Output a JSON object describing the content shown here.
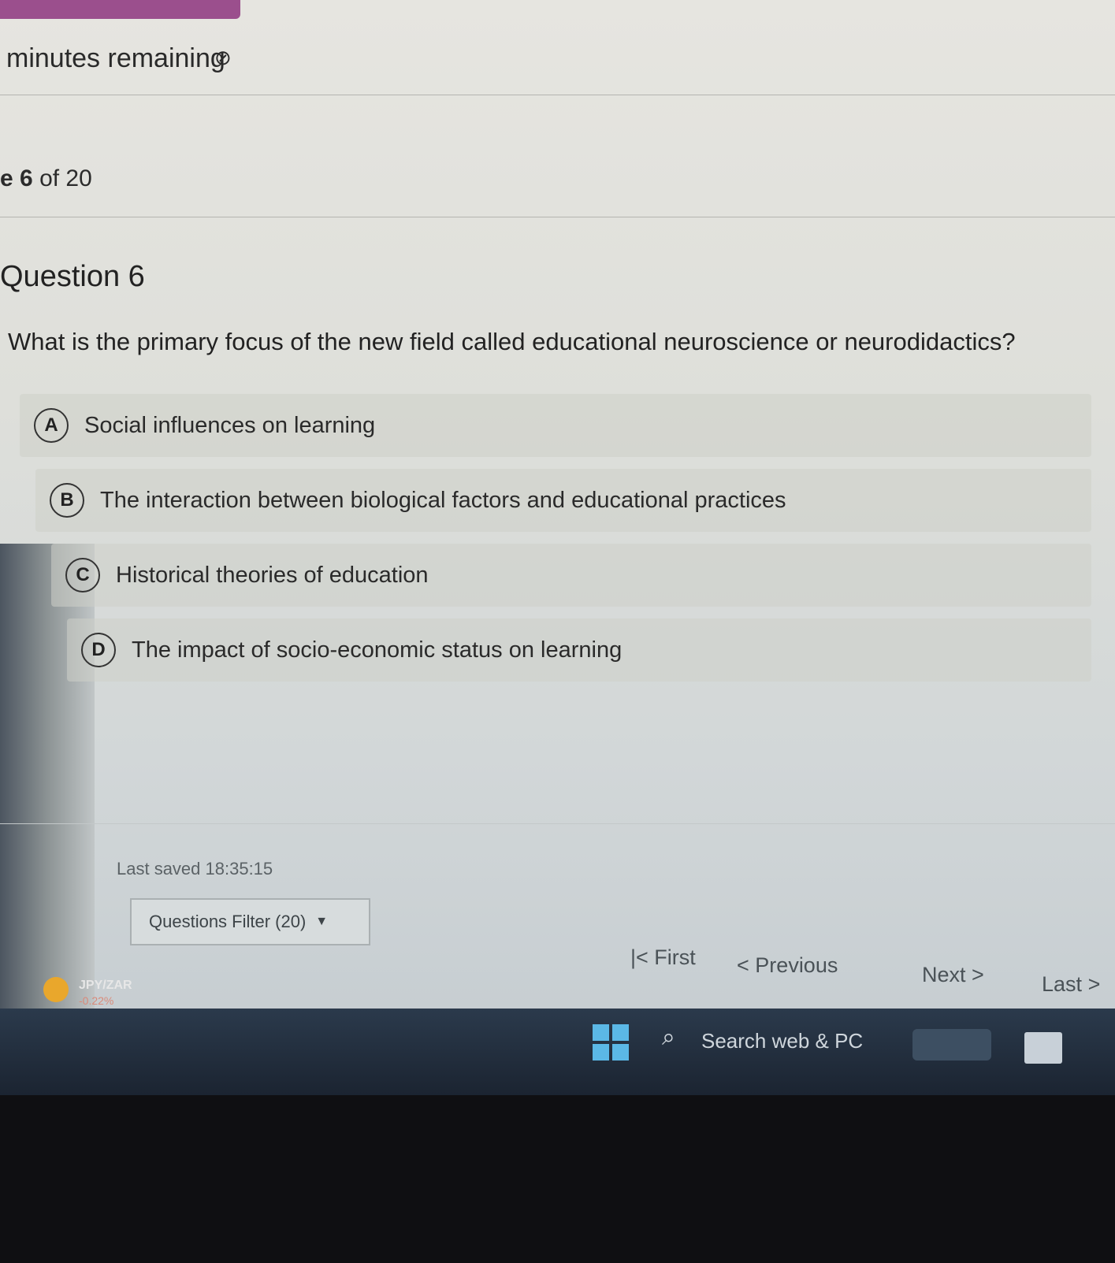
{
  "header": {
    "timer_text": "minutes remaining",
    "hide_icon": "eye-slash-icon",
    "page_prefix": "e",
    "page_current": "6",
    "page_suffix": "of 20"
  },
  "question": {
    "heading": "Question 6",
    "text": "What is the primary focus of the new field called educational neuroscience or neurodidactics?",
    "options": [
      {
        "letter": "A",
        "text": "Social influences on learning"
      },
      {
        "letter": "B",
        "text": "The interaction between biological factors and educational practices"
      },
      {
        "letter": "C",
        "text": "Historical theories of education"
      },
      {
        "letter": "D",
        "text": "The impact of socio-economic status on learning"
      }
    ]
  },
  "footer": {
    "last_saved": "Last saved 18:35:15",
    "filter_label": "Questions Filter (20)",
    "nav": {
      "first": "First",
      "previous": "Previous",
      "next": "Next",
      "last": "Last"
    }
  },
  "taskbar": {
    "ticker_name": "JPY/ZAR",
    "ticker_change": "-0.22%",
    "search_placeholder": "Search web & PC",
    "search_icon": "search-icon",
    "start_icon": "windows-logo-icon"
  },
  "colors": {
    "accent": "#9b4f8d",
    "taskbar": "#1b2431"
  }
}
